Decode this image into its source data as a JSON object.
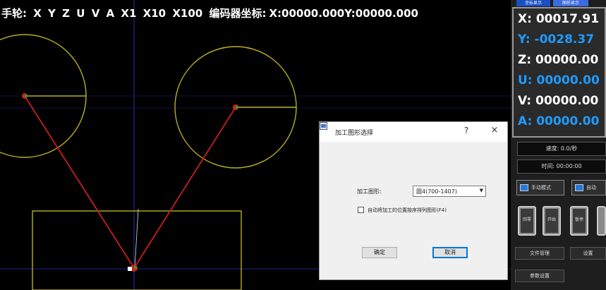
{
  "hud": {
    "jog_label": "手轮:",
    "axes": [
      "X",
      "Y",
      "Z",
      "U",
      "V",
      "A"
    ],
    "multipliers": [
      "X1",
      "X10",
      "X100"
    ],
    "encoder_label": "编码器坐标:",
    "encoder_x": "X:00000.000",
    "encoder_y": "Y:00000.000"
  },
  "dialog": {
    "title": "加工图形选择",
    "help": "?",
    "close": "×",
    "file_label": "加工图形:",
    "file_value": "圆4(700-1407)",
    "checkbox_label": "自动将加工的位置按序排列图形(F4)",
    "ok_label": "确定",
    "cancel_label": "取消"
  },
  "panel": {
    "tabs": [
      "坐标显示",
      "图形显示"
    ],
    "coords": {
      "x": "X: 00017.91",
      "y": "Y: -0028.37",
      "z": "Z: 00000.00",
      "u": "U: 00000.00",
      "v": "V: 00000.00",
      "a": "A: 00000.00"
    },
    "speed": "速度: 0.0/秒",
    "time": "时间: 00:00:00",
    "mode_buttons": [
      "手动模式",
      "自动"
    ],
    "square_buttons": [
      "回零",
      "开始",
      "暂停",
      ""
    ],
    "small_buttons": [
      "文件管理",
      "设置",
      "参数设置"
    ]
  },
  "colors": {
    "circle": "#b8b020",
    "arm": "#c81e1e",
    "guide": "#1a2a8c",
    "coord_blue": "#1e9bff",
    "tab_active": "#1a4fc4"
  }
}
